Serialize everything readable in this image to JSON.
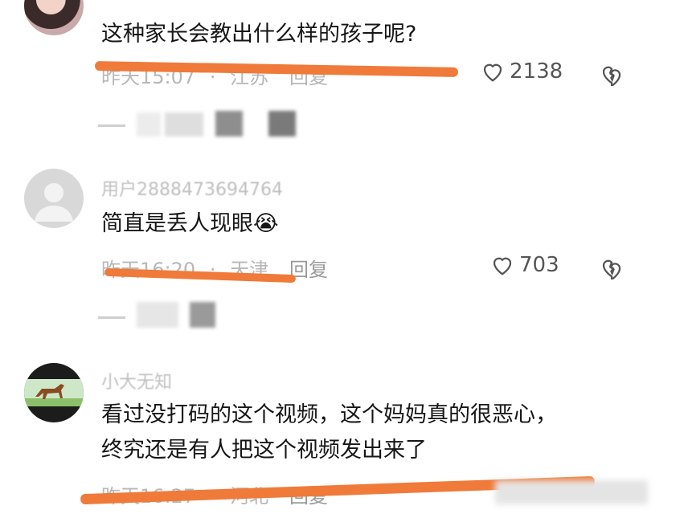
{
  "comments": [
    {
      "text": "这种家长会教出什么样的孩子呢?",
      "meta_time": "昨天15:07",
      "meta_loc": "江苏",
      "reply": "回复",
      "likes": "2138",
      "avatar": "photo-avatar"
    },
    {
      "username": "用户2888473694764",
      "text": "简直是丢人现眼",
      "emoji": "😭",
      "meta_time": "昨天16:20",
      "meta_loc": "天津",
      "reply": "回复",
      "likes": "703",
      "avatar": "default-avatar"
    },
    {
      "username": "小大无知",
      "text_line1": "看过没打码的这个视频，这个妈妈真的很恶心，",
      "text_line2": "终究还是有人把这个视频发出来了",
      "meta_time": "昨天16:27",
      "meta_loc": "河北",
      "reply": "回复",
      "avatar": "horse-avatar"
    }
  ],
  "colors": {
    "highlight": "#f07a3a",
    "meta": "#b7b7b7"
  }
}
